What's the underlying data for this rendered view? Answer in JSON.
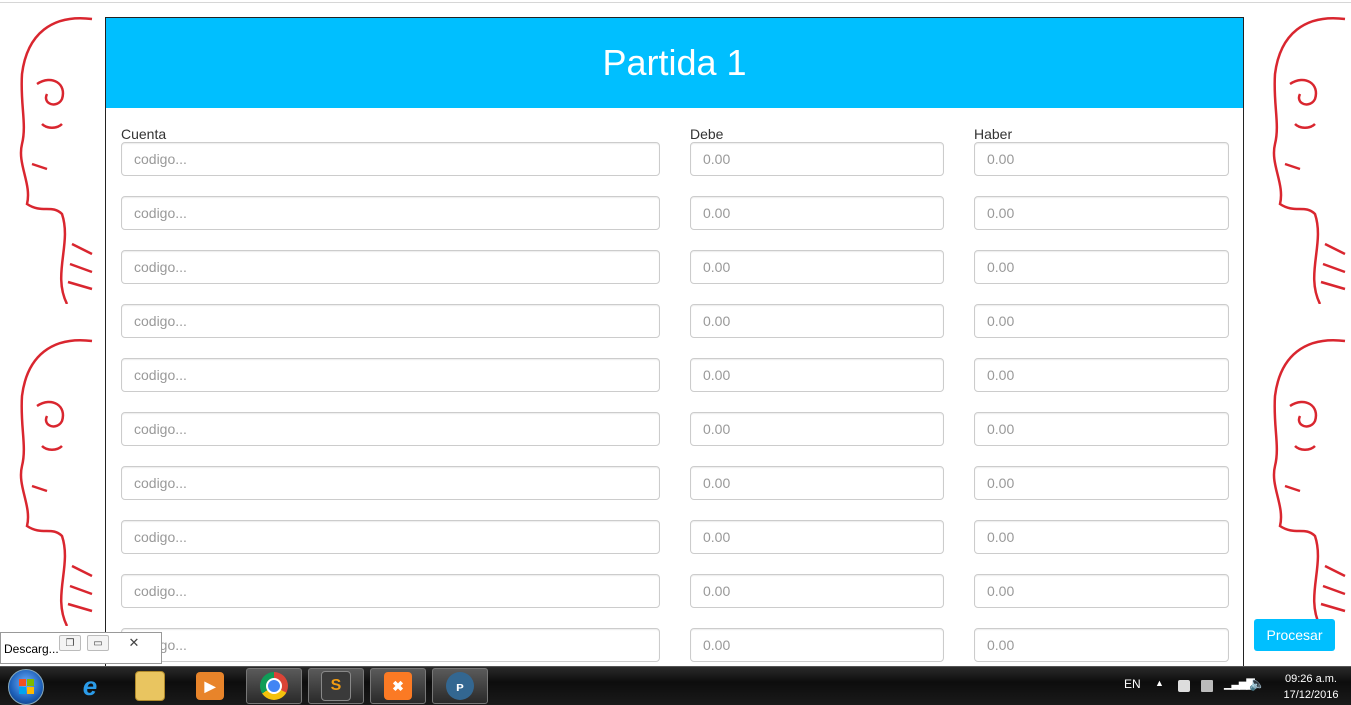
{
  "panel": {
    "title": "Partida 1",
    "headers": {
      "cuenta": "Cuenta",
      "debe": "Debe",
      "haber": "Haber"
    }
  },
  "rows": [
    {
      "cuenta_placeholder": "codigo...",
      "debe_placeholder": "0.00",
      "haber_placeholder": "0.00"
    },
    {
      "cuenta_placeholder": "codigo...",
      "debe_placeholder": "0.00",
      "haber_placeholder": "0.00"
    },
    {
      "cuenta_placeholder": "codigo...",
      "debe_placeholder": "0.00",
      "haber_placeholder": "0.00"
    },
    {
      "cuenta_placeholder": "codigo...",
      "debe_placeholder": "0.00",
      "haber_placeholder": "0.00"
    },
    {
      "cuenta_placeholder": "codigo...",
      "debe_placeholder": "0.00",
      "haber_placeholder": "0.00"
    },
    {
      "cuenta_placeholder": "codigo...",
      "debe_placeholder": "0.00",
      "haber_placeholder": "0.00"
    },
    {
      "cuenta_placeholder": "codigo...",
      "debe_placeholder": "0.00",
      "haber_placeholder": "0.00"
    },
    {
      "cuenta_placeholder": "codigo...",
      "debe_placeholder": "0.00",
      "haber_placeholder": "0.00"
    },
    {
      "cuenta_placeholder": "codigo...",
      "debe_placeholder": "0.00",
      "haber_placeholder": "0.00"
    },
    {
      "cuenta_placeholder": "codigo...",
      "debe_placeholder": "0.00",
      "haber_placeholder": "0.00"
    }
  ],
  "procesar_label": "Procesar",
  "download_bar": {
    "label": "Descarg..."
  },
  "taskbar": {
    "apps": [
      "start-orb",
      "internet-explorer",
      "file-explorer",
      "media-player",
      "chrome",
      "sublime-text",
      "xampp",
      "postgresql"
    ],
    "language": "EN",
    "time": "09:26 a.m.",
    "date": "17/12/2016"
  },
  "colors": {
    "accent": "#00bfff",
    "background_art": "#d9262f"
  }
}
